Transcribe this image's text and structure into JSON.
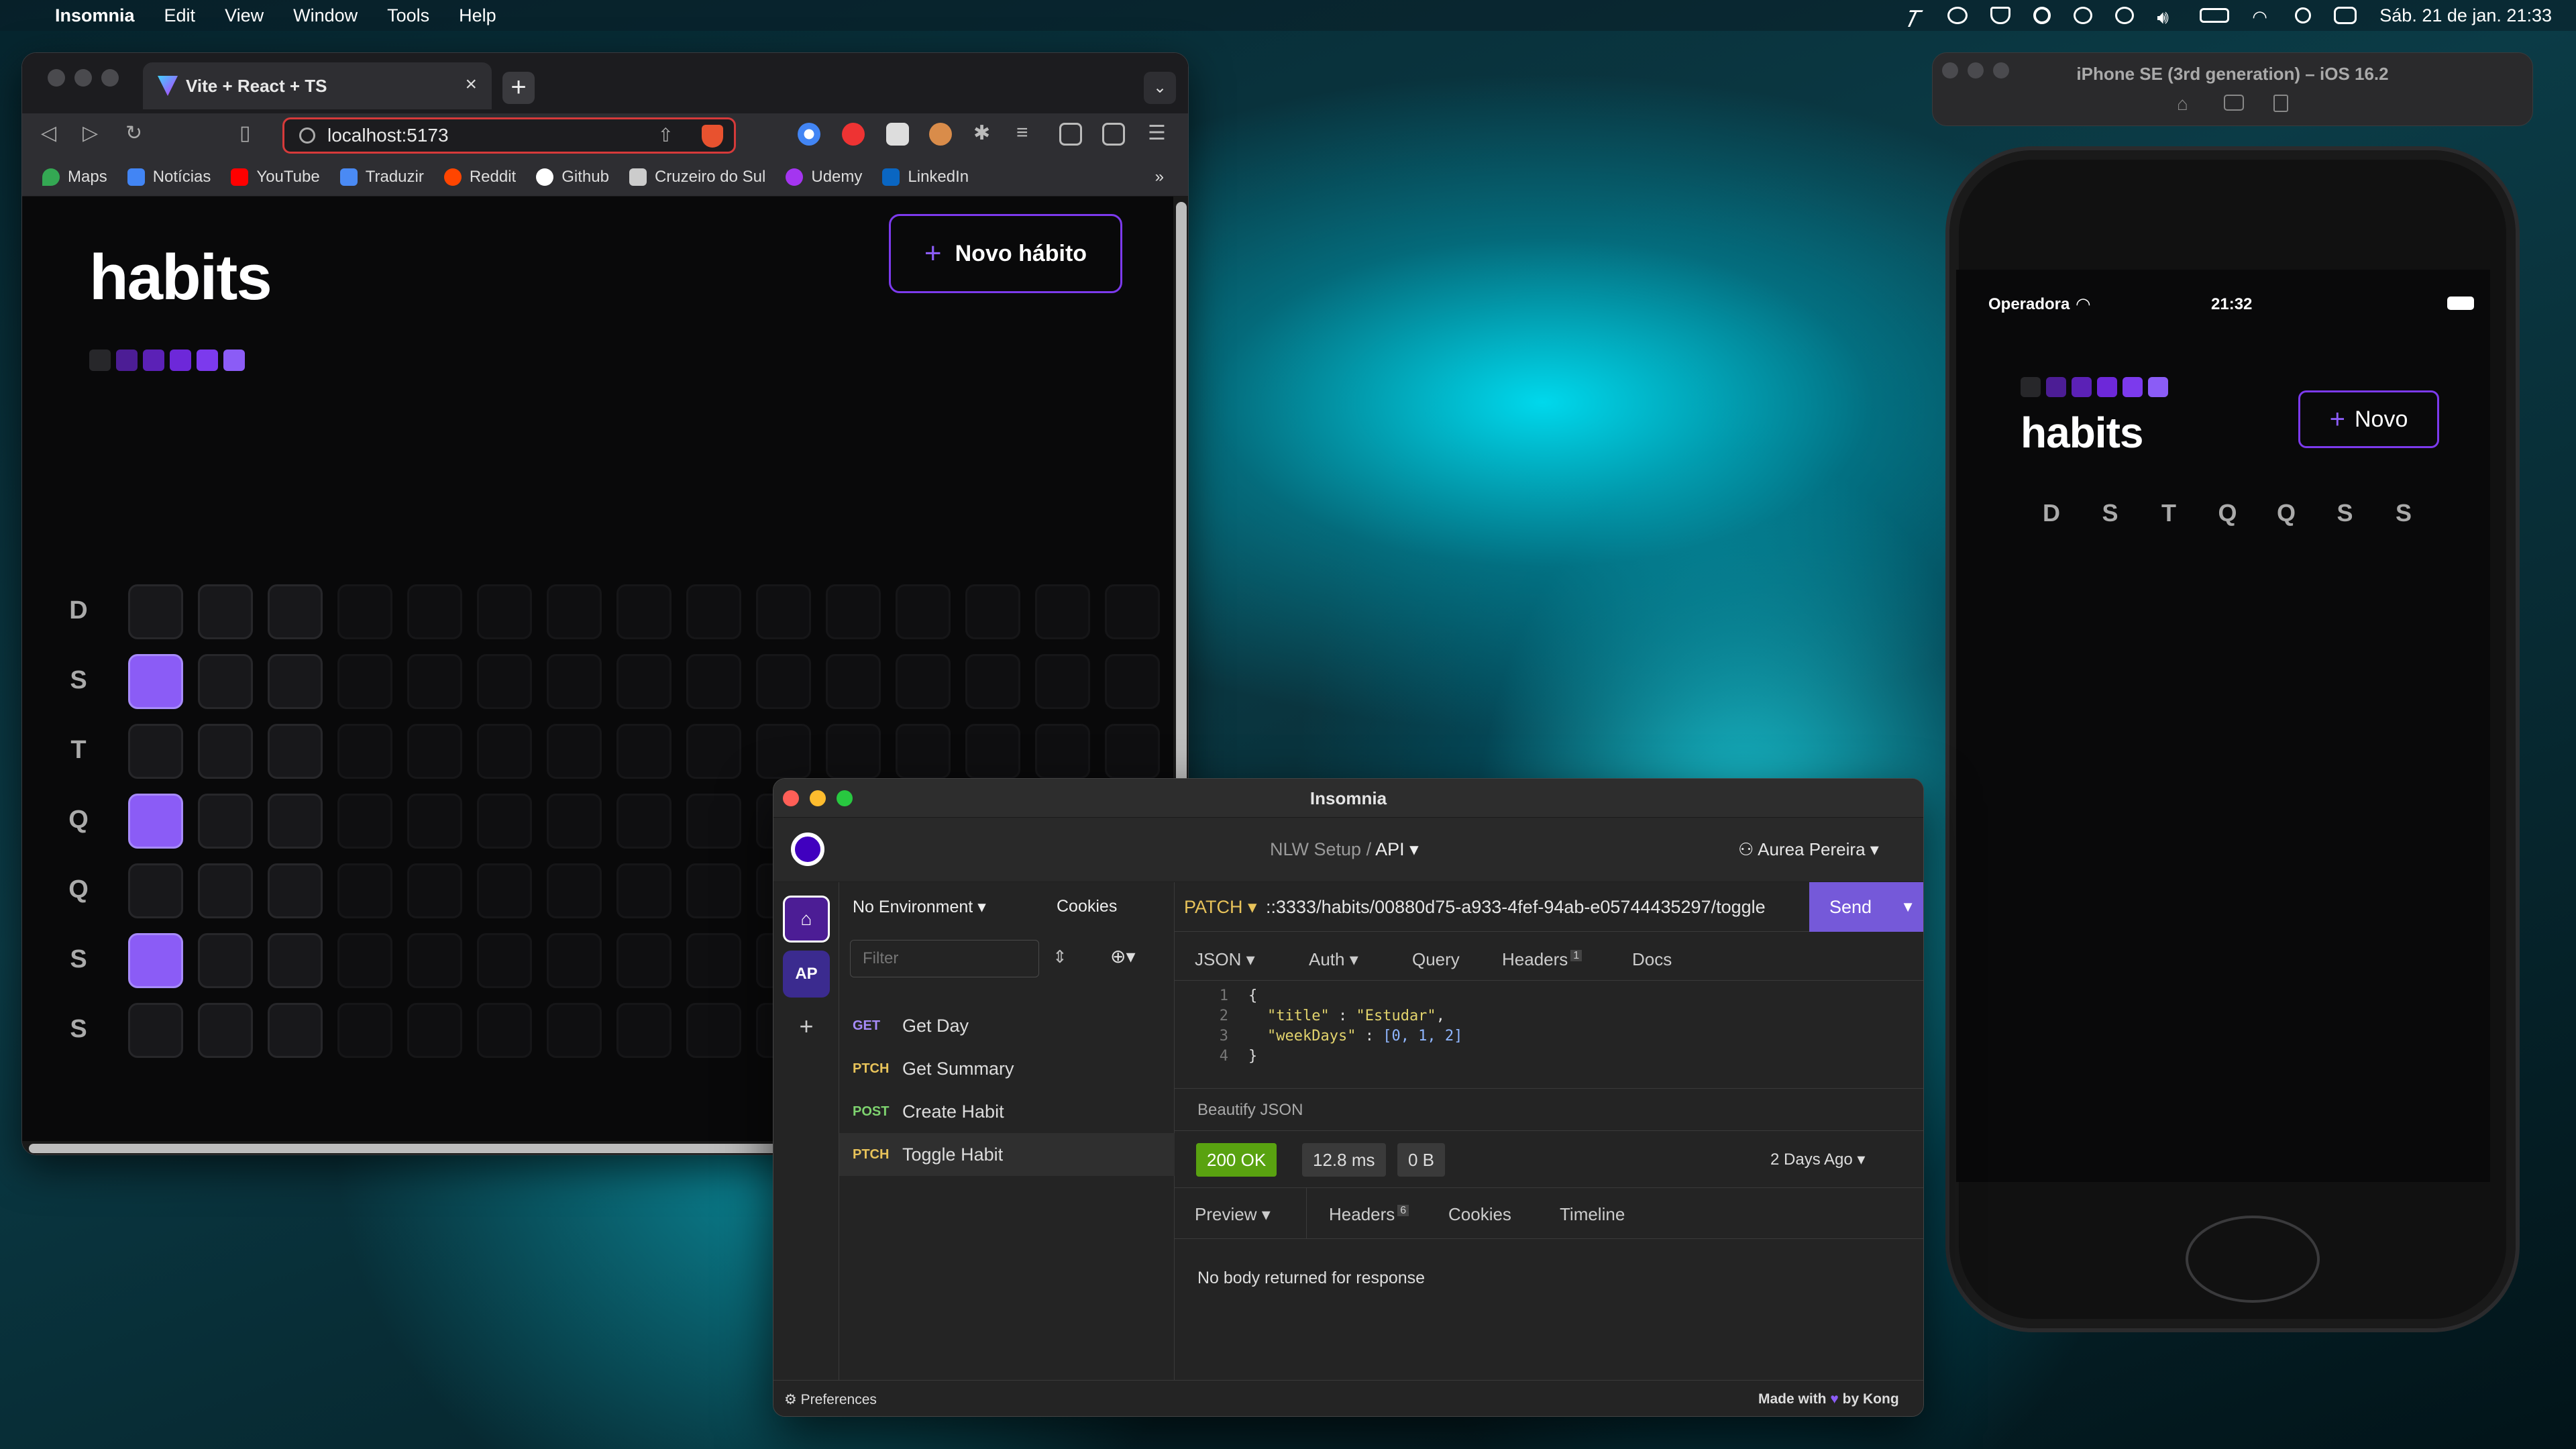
{
  "menubar": {
    "app": "Insomnia",
    "items": [
      "Edit",
      "View",
      "Window",
      "Tools",
      "Help"
    ],
    "datetime": "Sáb. 21 de jan.  21:33"
  },
  "browser": {
    "tab_title": "Vite + React + TS",
    "url": "localhost:5173",
    "bookmarks": [
      "Maps",
      "Notícias",
      "YouTube",
      "Traduzir",
      "Reddit",
      "Github",
      "Cruzeiro do Sul",
      "Udemy",
      "LinkedIn"
    ],
    "bookmarks_overflow": "»"
  },
  "web_app": {
    "title": "habits",
    "new_button": "Novo hábito",
    "weekdays": [
      "D",
      "S",
      "T",
      "Q",
      "Q",
      "S",
      "S"
    ],
    "completed_rows": [
      1,
      3,
      5
    ],
    "colors": {
      "accent": "#8b5cf6",
      "border": "#7c3aed"
    }
  },
  "insomnia": {
    "window_title": "Insomnia",
    "breadcrumb_project": "NLW Setup",
    "breadcrumb_sep": "/",
    "breadcrumb_collection": "API",
    "user": "Aurea Pereira",
    "rail_workspace": "AP",
    "environment": "No Environment",
    "cookies": "Cookies",
    "filter_placeholder": "Filter",
    "requests": [
      {
        "method": "GET",
        "name": "Get Day",
        "color": "#a78bfa"
      },
      {
        "method": "PTCH",
        "name": "Get Summary",
        "color": "#e8c35a"
      },
      {
        "method": "POST",
        "name": "Create Habit",
        "color": "#7ed36f"
      },
      {
        "method": "PTCH",
        "name": "Toggle Habit",
        "color": "#e8c35a"
      }
    ],
    "method": "PATCH",
    "url": "::3333/habits/00880d75-a933-4fef-94ab-e05744435297/toggle",
    "send": "Send",
    "tabs": {
      "body": "JSON",
      "auth": "Auth",
      "query": "Query",
      "headers": "Headers",
      "headers_count": "1",
      "docs": "Docs"
    },
    "code_lines": [
      "1",
      "2",
      "3",
      "4"
    ],
    "code": {
      "open": "{",
      "title_key": "\"title\"",
      "colon": " : ",
      "title_val": "\"Estudar\"",
      "weekdays_key": "\"weekDays\"",
      "weekdays_val": "[0, 1, 2]",
      "close": "}"
    },
    "beautify": "Beautify JSON",
    "status": "200 OK",
    "time": "12.8 ms",
    "size": "0 B",
    "ago": "2 Days Ago",
    "res_tabs": {
      "preview": "Preview",
      "headers": "Headers",
      "headers_count": "6",
      "cookies": "Cookies",
      "timeline": "Timeline"
    },
    "no_body": "No body returned for response",
    "preferences": "Preferences",
    "made_with": "Made with",
    "by_kong": "by Kong"
  },
  "simulator": {
    "title": "iPhone SE (3rd generation) – iOS 16.2",
    "carrier": "Operadora",
    "time": "21:32",
    "app_title": "habits",
    "new_button": "Novo",
    "weekdays": [
      "D",
      "S",
      "T",
      "Q",
      "Q",
      "S",
      "S"
    ]
  }
}
